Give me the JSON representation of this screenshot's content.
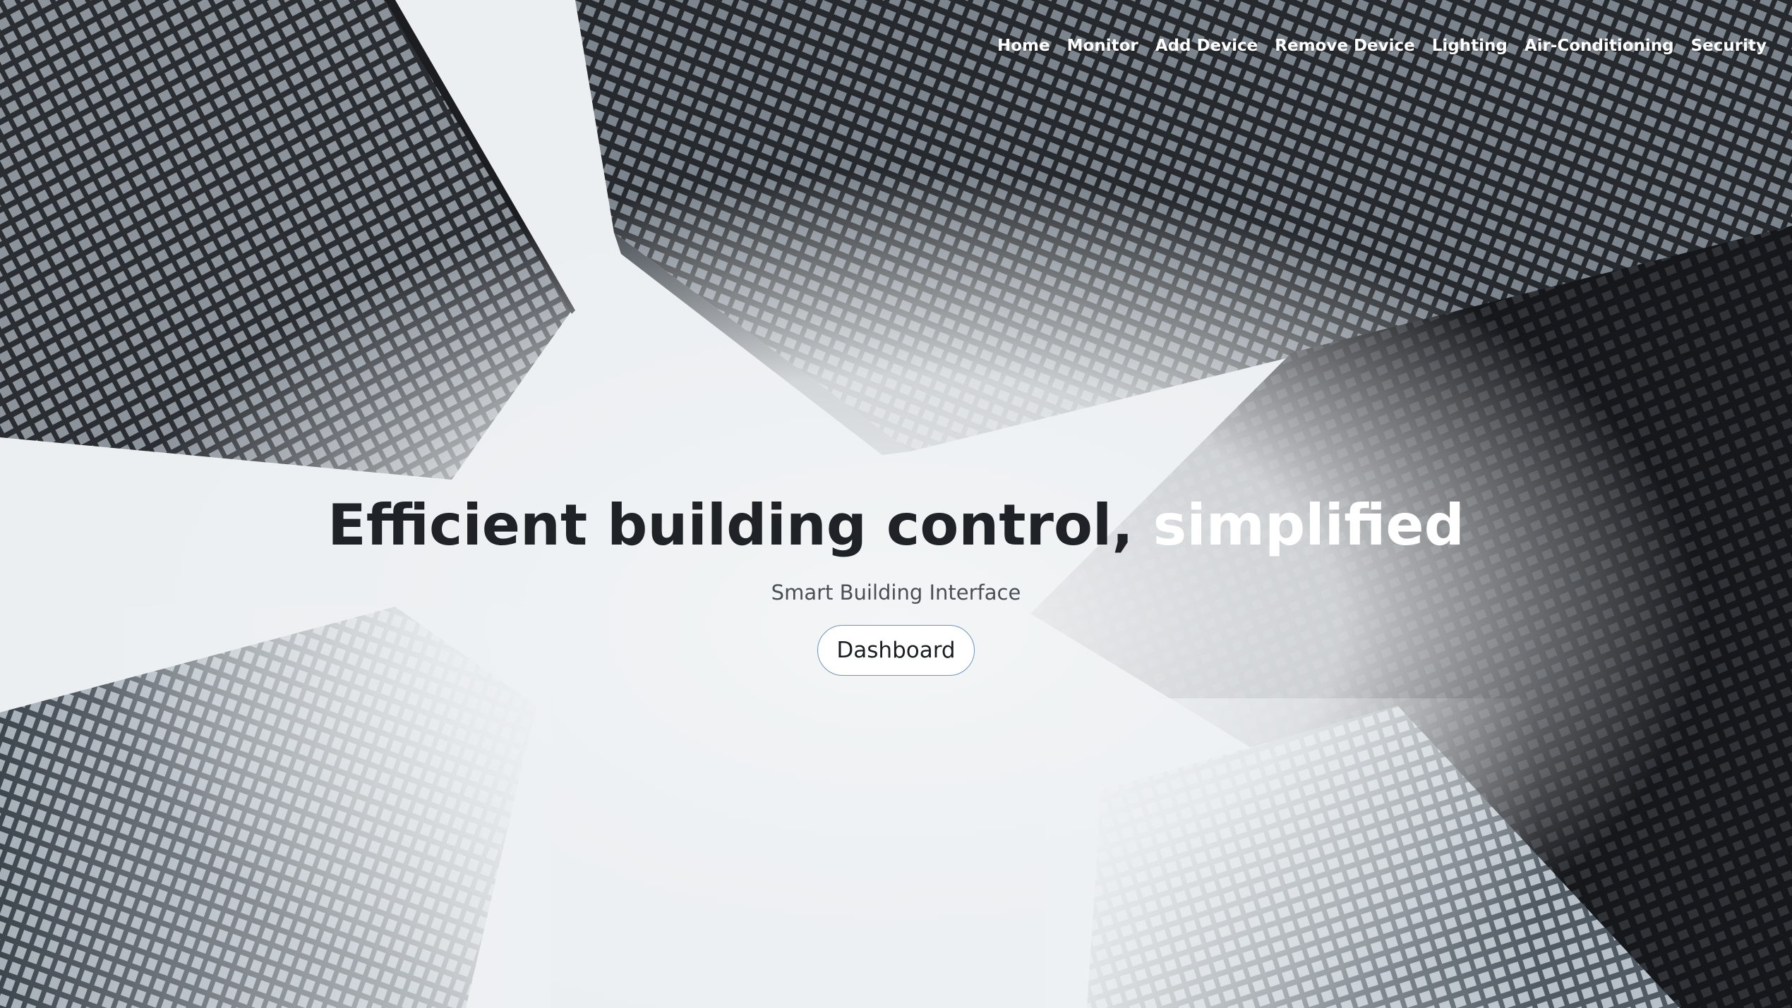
{
  "nav": {
    "items": [
      {
        "label": "Home"
      },
      {
        "label": "Monitor"
      },
      {
        "label": "Add Device"
      },
      {
        "label": "Remove Device"
      },
      {
        "label": "Lighting"
      },
      {
        "label": "Air-Conditioning"
      },
      {
        "label": "Security"
      }
    ]
  },
  "hero": {
    "headline_dark": "Efficient building control,",
    "headline_light": " simplified",
    "subtitle": "Smart Building Interface",
    "button_label": "Dashboard",
    "background_image": "skyscrapers-looking-up-photo"
  },
  "colors": {
    "headline_dark": "#1f2328",
    "headline_light": "#ffffff",
    "nav_text": "#ffffff",
    "button_border": "#6f93bf",
    "sky": "#eef1f3"
  }
}
